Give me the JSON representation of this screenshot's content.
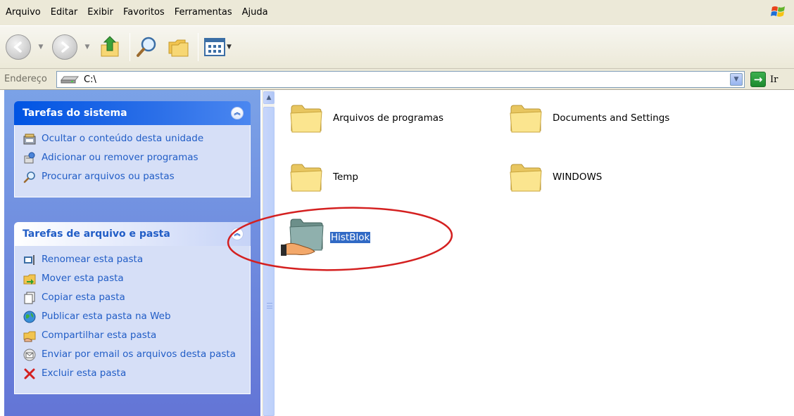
{
  "menu": [
    "Arquivo",
    "Editar",
    "Exibir",
    "Favoritos",
    "Ferramentas",
    "Ajuda"
  ],
  "address": {
    "label": "Endereço",
    "path": "C:\\",
    "go_label": "Ir"
  },
  "tasks_system": {
    "title": "Tarefas do sistema",
    "items": [
      "Ocultar o conteúdo desta unidade",
      "Adicionar ou remover programas",
      "Procurar arquivos ou pastas"
    ]
  },
  "tasks_file": {
    "title": "Tarefas de arquivo e pasta",
    "items": [
      "Renomear esta pasta",
      "Mover esta pasta",
      "Copiar esta pasta",
      "Publicar esta pasta na Web",
      "Compartilhar esta pasta",
      "Enviar por email os arquivos desta pasta",
      "Excluir esta pasta"
    ]
  },
  "folders": [
    {
      "name": "Arquivos de programas",
      "icon": "folder-icon"
    },
    {
      "name": "Documents and Settings",
      "icon": "folder-icon"
    },
    {
      "name": "Temp",
      "icon": "folder-icon"
    },
    {
      "name": "WINDOWS",
      "icon": "folder-icon"
    },
    {
      "name": "HistBlok",
      "icon": "shared-folder-icon",
      "selected": true
    }
  ],
  "colors": {
    "link": "#215dc6",
    "selection": "#316ac5",
    "annotation": "#d42020"
  }
}
